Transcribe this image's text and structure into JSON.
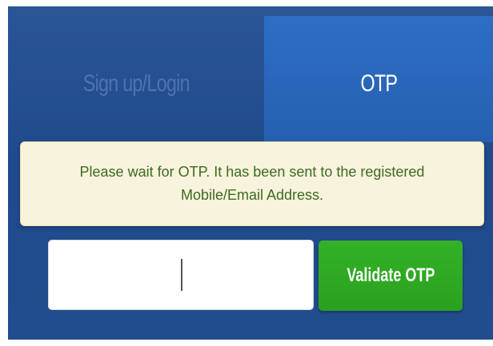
{
  "tabs": {
    "signup_label": "Sign up/Login",
    "otp_label": "OTP",
    "active": "OTP"
  },
  "notice": {
    "message": "Please wait for OTP. It has been sent to the registered Mobile/Email Address."
  },
  "otp_form": {
    "input_value": "",
    "button_label": "Validate OTP"
  },
  "colors": {
    "background": "#1f4a8b",
    "active_tab": "#2764b5",
    "inactive_tab_text": "#4f73ad",
    "notice_bg": "#f8f3dc",
    "notice_text": "#3c6b21",
    "button": "#2fa923"
  }
}
